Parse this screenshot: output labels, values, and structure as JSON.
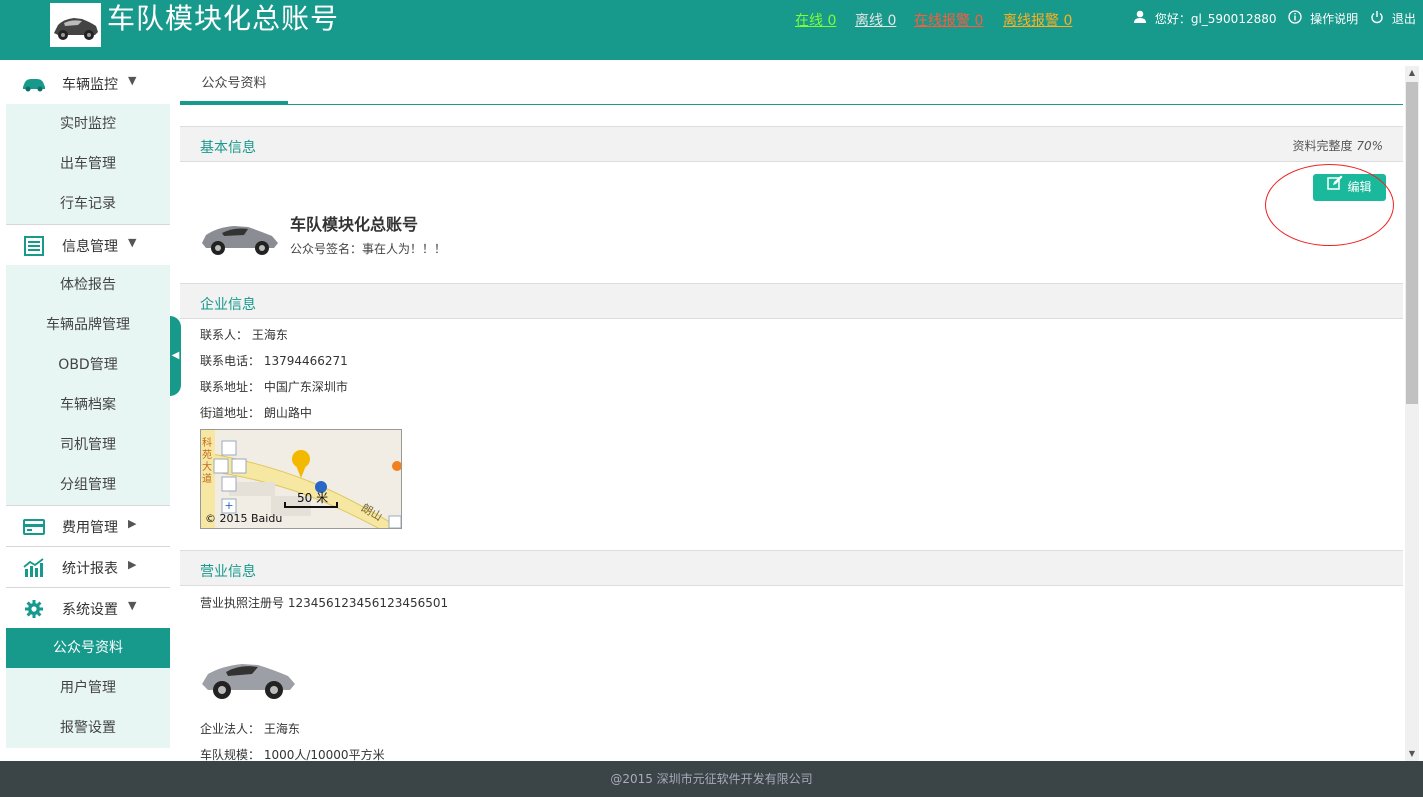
{
  "header": {
    "title": "车队模块化总账号",
    "online": "在线 0",
    "offline": "离线 0",
    "online_alarm": "在线报警 0",
    "offline_alarm": "离线报警 0",
    "greeting": "您好：gl_590012880",
    "help": "操作说明",
    "logout": "退出"
  },
  "sidebar": {
    "groups": [
      {
        "label": "车辆监控",
        "icon": "car-icon"
      },
      {
        "label": "信息管理",
        "icon": "list-icon"
      },
      {
        "label": "费用管理",
        "icon": "card-icon"
      },
      {
        "label": "统计报表",
        "icon": "chart-icon"
      },
      {
        "label": "系统设置",
        "icon": "gear-icon"
      }
    ],
    "vehicle_items": [
      "实时监控",
      "出车管理",
      "行车记录"
    ],
    "info_items": [
      "体检报告",
      "车辆品牌管理",
      "OBD管理",
      "车辆档案",
      "司机管理",
      "分组管理"
    ],
    "system_items": [
      "公众号资料",
      "用户管理",
      "报警设置"
    ]
  },
  "tab": {
    "label": "公众号资料"
  },
  "basic": {
    "title": "基本信息",
    "completeness_label": "资料完整度",
    "completeness_value": "70%",
    "edit_label": "编辑",
    "name": "车队模块化总账号",
    "signature": "公众号签名：事在人为！！！"
  },
  "enterprise": {
    "title": "企业信息",
    "contact": "联系人： 王海东",
    "phone": "联系电话： 13794466271",
    "address": "联系地址： 中国广东深圳市",
    "street": "街道地址： 朗山路中"
  },
  "map": {
    "scale": "50 米",
    "copyright": "© 2015 Baidu",
    "road_label": "朗山",
    "side_text": "科苑大道"
  },
  "business": {
    "title": "营业信息",
    "license": "营业执照注册号 123456123456123456501",
    "legal_person": "企业法人： 王海东",
    "scale": "车队规模： 1000人/10000平方米"
  },
  "footer": {
    "text": "@2015 深圳市元征软件开发有限公司"
  },
  "colors": {
    "primary": "#17998c",
    "online": "#7cfc3c",
    "offline": "#e6e6e6",
    "online_alarm": "#ff5a3c",
    "offline_alarm": "#ffb020",
    "edit": "#1ab99c",
    "highlight_circle": "#e22222"
  }
}
